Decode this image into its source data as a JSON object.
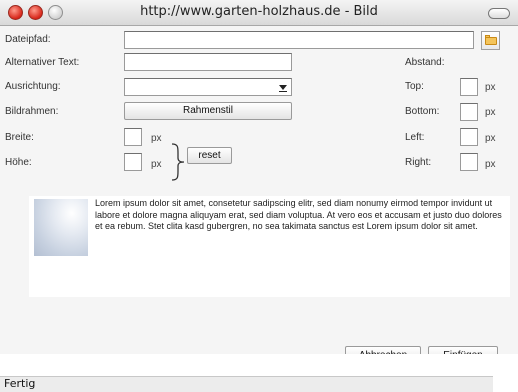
{
  "window": {
    "title": "http://www.garten-holzhaus.de - Bild"
  },
  "form": {
    "path_label": "Dateipfad:",
    "path_value": "",
    "alt_label": "Alternativer Text:",
    "alt_value": "",
    "align_label": "Ausrichtung:",
    "align_value": "",
    "frame_label": "Bildrahmen:",
    "frame_button": "Rahmenstil",
    "width_label": "Breite:",
    "width_value": "",
    "height_label": "Höhe:",
    "height_value": "",
    "unit": "px",
    "reset_button": "reset"
  },
  "spacing": {
    "heading": "Abstand:",
    "top_label": "Top:",
    "bottom_label": "Bottom:",
    "left_label": "Left:",
    "right_label": "Right:",
    "unit": "px",
    "top_value": "",
    "bottom_value": "",
    "left_value": "",
    "right_value": ""
  },
  "preview": {
    "text": "Lorem ipsum dolor sit amet, consetetur sadipscing elitr, sed diam nonumy eirmod tempor invidunt ut labore et dolore magna aliquyam erat, sed diam voluptua. At vero eos et accusam et justo duo dolores et ea rebum. Stet clita kasd gubergren, no sea takimata sanctus est Lorem ipsum dolor sit amet."
  },
  "actions": {
    "cancel": "Abbrechen",
    "insert": "Einfügen"
  },
  "status": {
    "text": "Fertig"
  },
  "colors": {
    "close": "#d7261a",
    "folder": "#f4c45a"
  }
}
